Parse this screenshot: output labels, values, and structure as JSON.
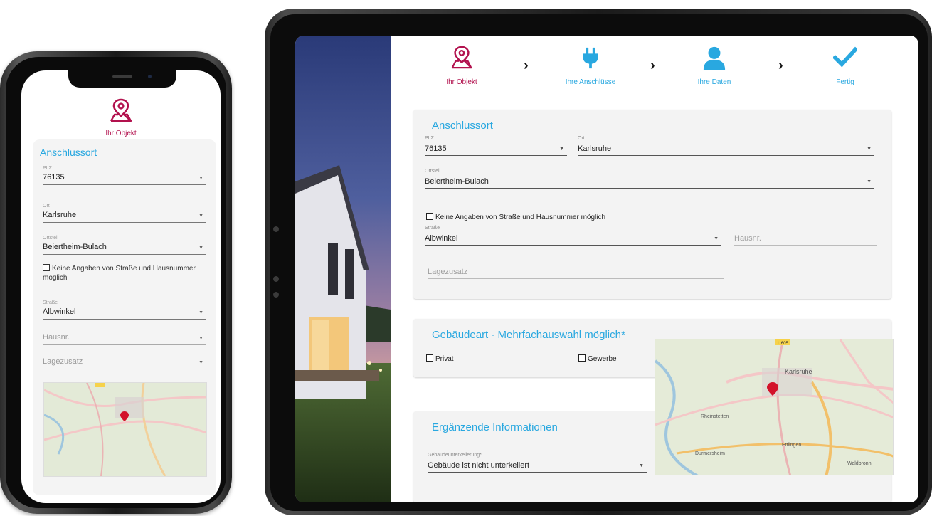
{
  "steps": [
    {
      "label": "Ihr Objekt",
      "icon": "map-pin-icon",
      "active": true
    },
    {
      "label": "Ihre Anschlüsse",
      "icon": "plug-icon",
      "active": false
    },
    {
      "label": "Ihre Daten",
      "icon": "user-icon",
      "active": false
    },
    {
      "label": "Fertig",
      "icon": "checkmark-icon",
      "active": false
    }
  ],
  "anschlussort": {
    "title": "Anschlussort",
    "plz": {
      "label": "PLZ",
      "value": "76135"
    },
    "ort": {
      "label": "Ort",
      "value": "Karlsruhe"
    },
    "ortsteil": {
      "label": "Ortsteil",
      "value": "Beiertheim-Bulach"
    },
    "no_street_checkbox": "Keine Angaben von Straße und Hausnummer möglich",
    "strasse": {
      "label": "Straße",
      "value": "Albwinkel"
    },
    "hausnr": {
      "placeholder": "Hausnr."
    },
    "lagezusatz": {
      "placeholder": "Lagezusatz"
    }
  },
  "gebaeudeart": {
    "title": "Gebäudeart - Mehrfachauswahl möglich*",
    "options": [
      "Privat",
      "Gewerbe"
    ]
  },
  "ergaenzende": {
    "title": "Ergänzende Informationen",
    "unterkellerung": {
      "label": "Gebäudeunterkellerung*",
      "value": "Gebäude ist nicht unterkellert"
    }
  },
  "map": {
    "road_badge": "L 605",
    "places": [
      "Karlsruhe",
      "Rheinstetten",
      "Ettlingen",
      "Durmersheim",
      "Waldbronn"
    ]
  },
  "colors": {
    "brand_magenta": "#b2124e",
    "accent_blue": "#29a8e0",
    "card_bg": "#f3f3f3"
  }
}
